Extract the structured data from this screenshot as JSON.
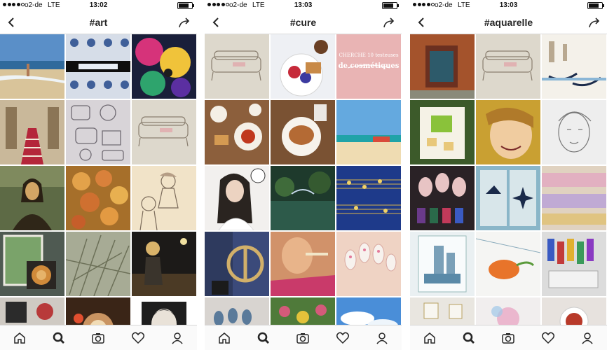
{
  "colors": {
    "icon": "#262626",
    "separator": "#dcdcdc",
    "tabbar_bg": "#fafafa"
  },
  "icons": {
    "back": "chevron-left-icon",
    "share": "share-arrow-icon",
    "home": "home-icon",
    "search": "search-icon",
    "camera": "camera-icon",
    "activity": "heart-icon",
    "profile": "person-icon"
  },
  "screens": [
    {
      "carrier": "o2-de",
      "network": "LTE",
      "time": "13:02",
      "title": "#art",
      "battery_fraction": 0.8,
      "signal_bars": 4
    },
    {
      "carrier": "o2-de",
      "network": "LTE",
      "time": "13:03",
      "title": "#cure",
      "battery_fraction": 0.8,
      "signal_bars": 4
    },
    {
      "carrier": "o2-de",
      "network": "LTE",
      "time": "13:03",
      "title": "#aquarelle",
      "battery_fraction": 0.8,
      "signal_bars": 4
    }
  ],
  "tiles": {
    "art": [
      "beach",
      "blue-tiles",
      "abstract-colors",
      "palace-hall",
      "doodle-sketch",
      "sofa-sketch",
      "mona-lisa",
      "peaches-painting",
      "manga-sketch",
      "lion-window",
      "grass",
      "dark-figure",
      "mural",
      "latte-hands",
      "portrait-drawing"
    ],
    "cure": [
      "sofa-sketch",
      "breakfast-plate",
      "pink-text-card",
      "breakfast-table",
      "pancake",
      "beach-sky",
      "girl-portrait",
      "garden-pond",
      "sheet-music",
      "peace-sign-jeans",
      "girl-drinking",
      "nails",
      "nails-grey",
      "garden-flowers",
      "clouds"
    ],
    "aquarelle": [
      "old-door",
      "sofa-sketch",
      "venice-gondolas",
      "green-cubes",
      "painted-face",
      "face-sketch",
      "nail-polish",
      "compass-boat",
      "paint-stripes",
      "castle-sketch",
      "watercolor-carrot",
      "paint-tubes",
      "frames-wall",
      "floral-drawing",
      "tea-cup"
    ]
  },
  "card_text": {
    "line1": "CHERCHE 10 testeuses",
    "line2": "de cosmétiques"
  }
}
